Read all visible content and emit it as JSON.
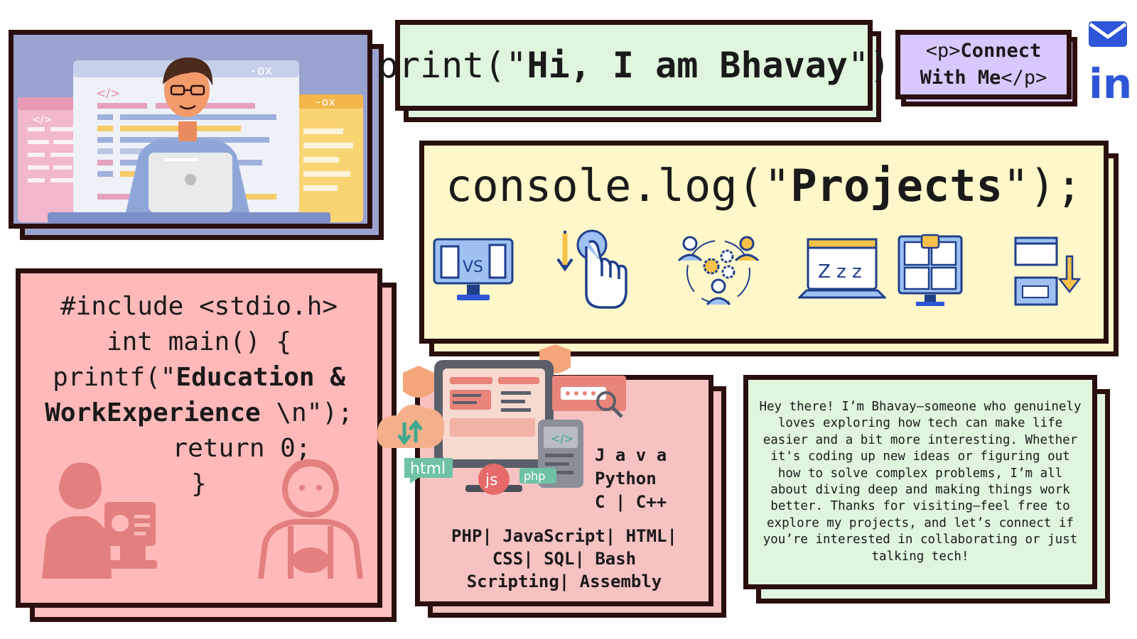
{
  "header": {
    "title_prefix": "print(\"",
    "title_name": "Hi, I am Bhavay",
    "title_suffix": "\")"
  },
  "connect": {
    "open_tag": "<p>",
    "text_line1": "Connect",
    "text_line2": "With Me",
    "close_tag": "</p>"
  },
  "social": {
    "email_icon": "mail-icon",
    "linkedin_label": "in",
    "linkedin_color": "#2f56d8"
  },
  "hero": {
    "code_tag": "</>",
    "window_controls": "-ox"
  },
  "projects": {
    "title_prefix": "console.log(\"",
    "title_word": "Projects",
    "title_suffix": "\");",
    "icon_vs_label": "VS",
    "icon_sleep_label": "Z z z",
    "icons": [
      "vs-monitor-icon",
      "tap-gesture-icon",
      "team-gears-icon",
      "sleep-laptop-icon",
      "screens-chat-icon",
      "windows-transfer-icon"
    ]
  },
  "education": {
    "line1": "#include <stdio.h>",
    "line2": "int main() {",
    "line3_prefix": "printf(\"",
    "line3_bold": "Education &",
    "line4_bold": "WorkExperience",
    "line4_suffix": " \\n\");",
    "line5": "return 0;",
    "line6": "}"
  },
  "skills": {
    "lang1": "J a v a",
    "lang2": "Python",
    "lang3": "C | C++",
    "list_line1": "PHP| JavaScript| HTML|",
    "list_line2": "CSS| SQL| Bash",
    "list_line3": "Scripting| Assembly",
    "badge_html": "html",
    "badge_js": "js",
    "badge_php": "php",
    "code_tag": "</>"
  },
  "about": {
    "text": "Hey there! I’m Bhavay—someone who genuinely loves exploring how tech can make life easier and a bit more interesting. Whether it's coding up new ideas or figuring out how to solve complex problems, I’m all about diving deep and making things work better. Thanks for visiting—feel free to explore my projects, and let’s connect if you’re interested in collaborating or just talking tech!"
  },
  "colors": {
    "border": "#2b0f0f",
    "title_bg": "#dff5dd",
    "connect_bg": "#d8c8ff",
    "projects_bg": "#fdf7c9",
    "education_bg": "#ffb9b9",
    "skills_bg": "#f7c2c2",
    "accent_blue": "#2f56d8"
  }
}
